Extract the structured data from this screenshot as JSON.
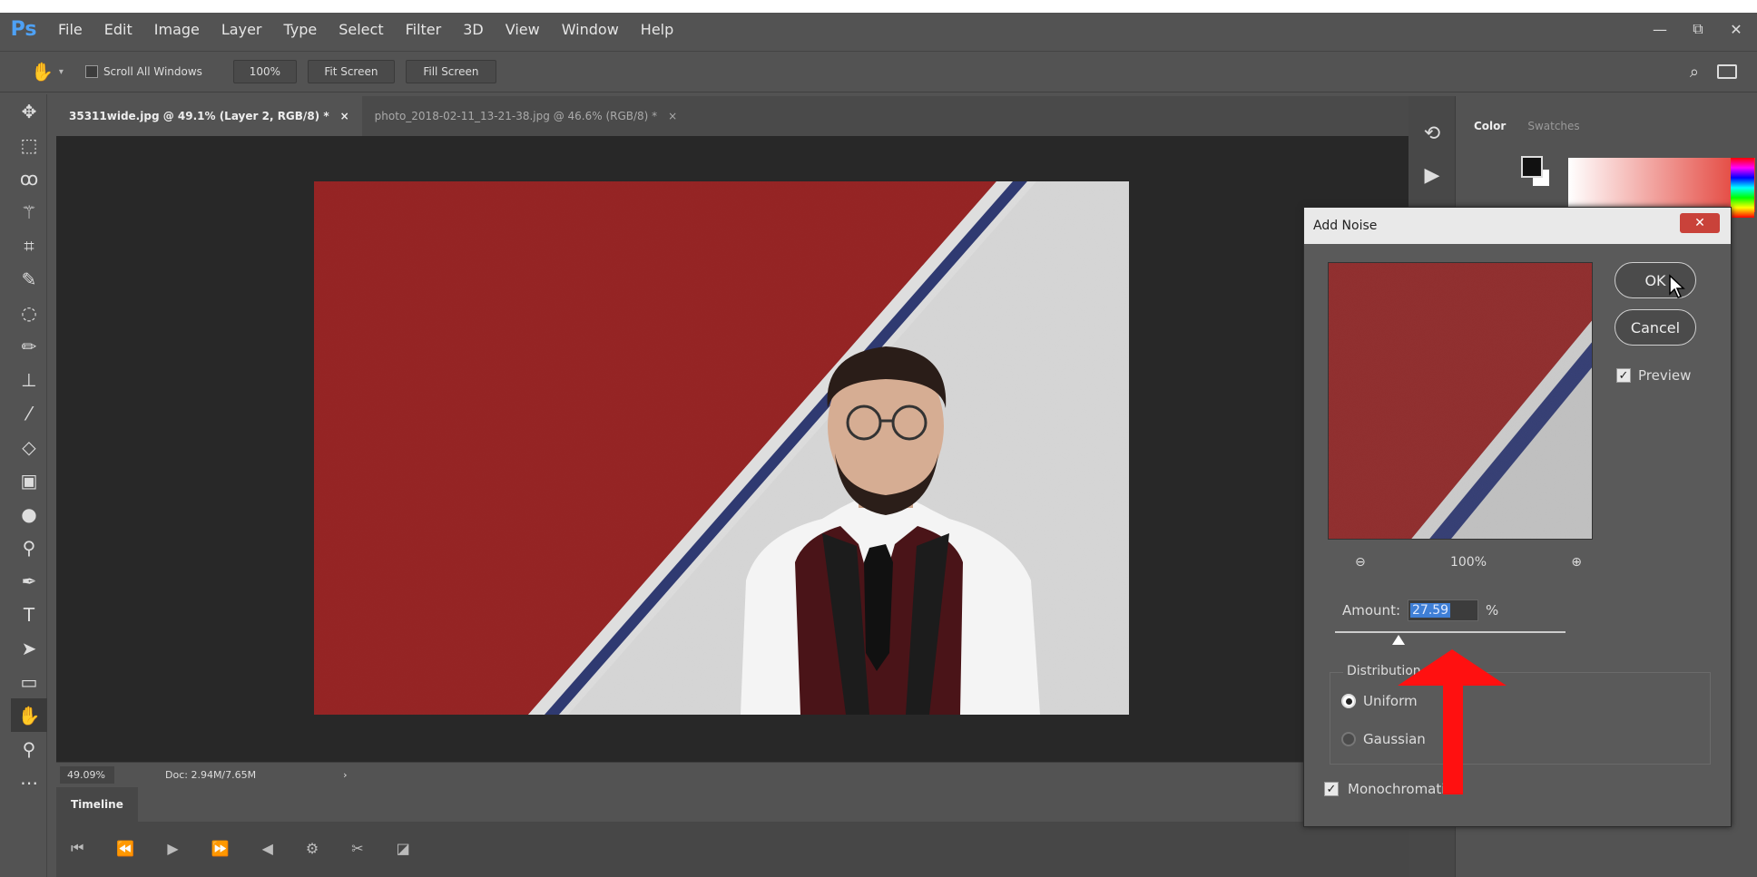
{
  "app": {
    "logo": "Ps",
    "menu": [
      "File",
      "Edit",
      "Image",
      "Layer",
      "Type",
      "Select",
      "Filter",
      "3D",
      "View",
      "Window",
      "Help"
    ],
    "window_controls": [
      "—",
      "⧉",
      "✕"
    ]
  },
  "options": {
    "scroll_all": "Scroll All Windows",
    "zoom": "100%",
    "fit": "Fit Screen",
    "fill": "Fill Screen"
  },
  "tabs": [
    {
      "label": "35311wide.jpg @ 49.1% (Layer 2, RGB/8) *",
      "close": "×"
    },
    {
      "label": "photo_2018-02-11_13-21-38.jpg @ 46.6% (RGB/8) *",
      "close": "×"
    }
  ],
  "status": {
    "zoom": "49.09%",
    "doc": "Doc: 2.94M/7.65M",
    "more": "›"
  },
  "timeline": {
    "tab": "Timeline"
  },
  "panels": {
    "color_tab": "Color",
    "swatches_tab": "Swatches"
  },
  "dialog": {
    "title": "Add Noise",
    "close": "✕",
    "ok": "OK",
    "cancel": "Cancel",
    "preview_label": "Preview",
    "preview_checked": true,
    "zoom_level": "100%",
    "amount_label": "Amount:",
    "amount_value": "27.59",
    "amount_unit": "%",
    "amount_slider_fraction": 0.2759,
    "distribution_label": "Distribution",
    "distribution_options": [
      "Uniform",
      "Gaussian"
    ],
    "distribution_selected": "Uniform",
    "monochromatic_label": "Monochromatic",
    "monochromatic_checked": true
  },
  "colors": {
    "accent": "#4ea1f5",
    "annotation_arrow": "#ff0000",
    "doc_red": "#9a1010",
    "doc_white": "#e8e8e8",
    "doc_blue": "#1d2a6e"
  }
}
